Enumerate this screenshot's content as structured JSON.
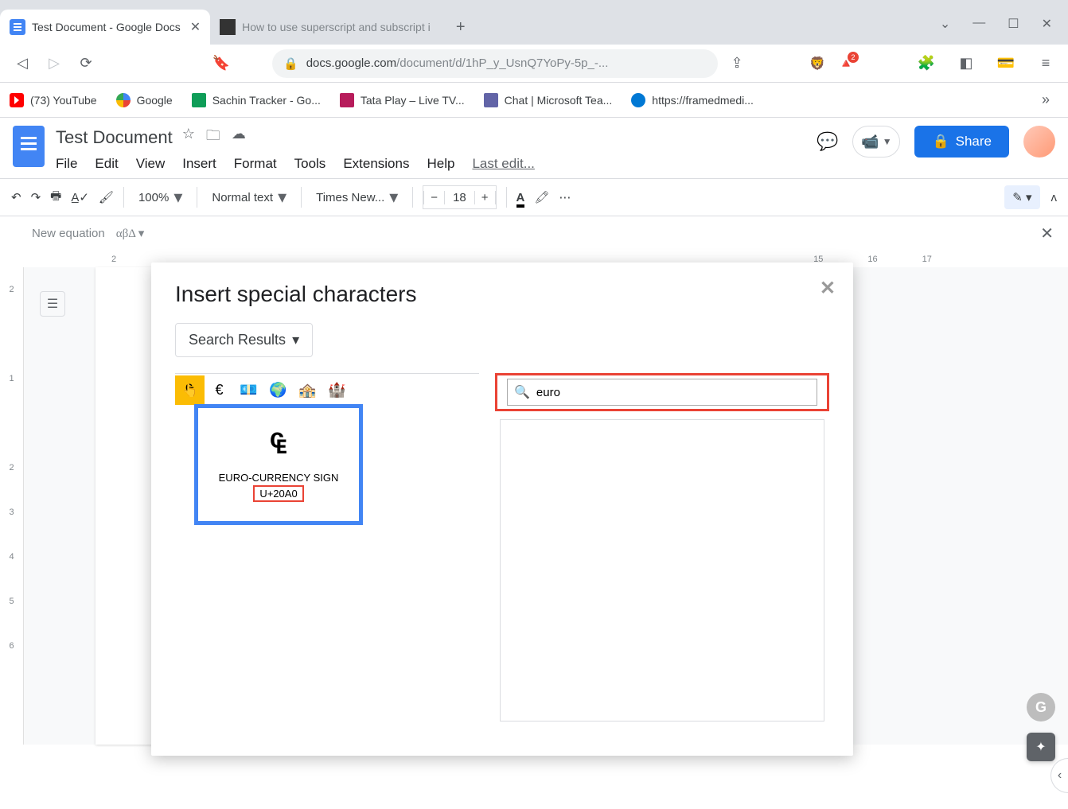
{
  "browser": {
    "tabs": [
      {
        "title": "Test Document - Google Docs",
        "active": true
      },
      {
        "title": "How to use superscript and subscript i",
        "active": false
      }
    ],
    "window_controls": {
      "dropdown": "⌄",
      "minimize": "—",
      "maximize": "☐",
      "close": "✕"
    },
    "url": {
      "domain": "docs.google.com",
      "path": "/document/d/1hP_y_UsnQ7YoPy-5p_-..."
    },
    "badge_count": "2"
  },
  "bookmarks": [
    {
      "label": "(73) YouTube"
    },
    {
      "label": "Google"
    },
    {
      "label": "Sachin Tracker - Go..."
    },
    {
      "label": "Tata Play – Live TV..."
    },
    {
      "label": "Chat | Microsoft Tea..."
    },
    {
      "label": "https://framedmedi..."
    }
  ],
  "docs": {
    "title": "Test Document",
    "menu": [
      "File",
      "Edit",
      "View",
      "Insert",
      "Format",
      "Tools",
      "Extensions",
      "Help"
    ],
    "last_edit": "Last edit...",
    "share": "Share"
  },
  "toolbar": {
    "zoom": "100%",
    "style": "Normal text",
    "font": "Times New...",
    "font_size": "18"
  },
  "equation_bar": "New equation",
  "ruler_marks": [
    "2",
    "15",
    "16",
    "17"
  ],
  "vruler_marks": [
    "2",
    "",
    "1",
    "",
    "2",
    "3",
    "4",
    "5",
    "6"
  ],
  "dialog": {
    "title": "Insert special characters",
    "category": "Search Results",
    "search_value": "euro",
    "chars": [
      "₠",
      "€",
      "💶",
      "🏤",
      "🏰"
    ],
    "emoji_globe": "🌍",
    "tooltip": {
      "glyph": "₠",
      "name": "EURO-CURRENCY SIGN",
      "code": "U+20A0"
    }
  }
}
